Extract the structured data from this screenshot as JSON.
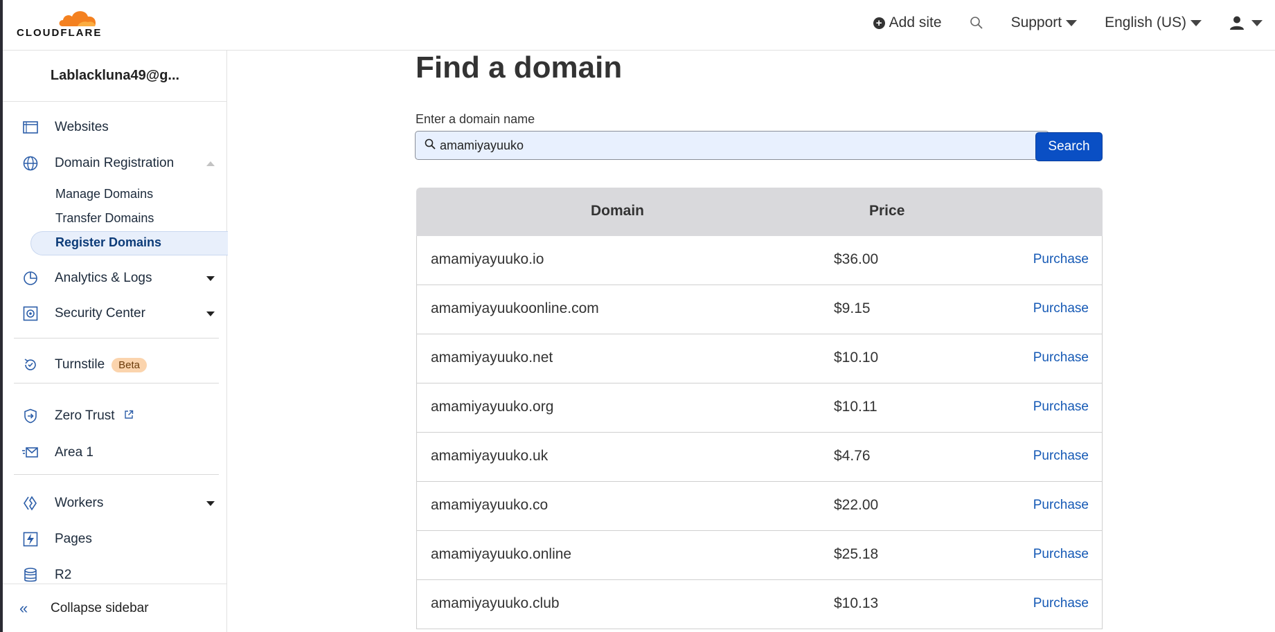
{
  "header": {
    "logo_text": "CLOUDFLARE",
    "add_site": "Add site",
    "support": "Support",
    "language": "English (US)"
  },
  "sidebar": {
    "account": "Lablackluna49@g...",
    "items": {
      "websites": "Websites",
      "domain_registration": "Domain Registration",
      "manage_domains": "Manage Domains",
      "transfer_domains": "Transfer Domains",
      "register_domains": "Register Domains",
      "analytics_logs": "Analytics & Logs",
      "security_center": "Security Center",
      "turnstile": "Turnstile",
      "turnstile_badge": "Beta",
      "zero_trust": "Zero Trust",
      "area1": "Area 1",
      "workers": "Workers",
      "pages": "Pages",
      "r2": "R2"
    },
    "collapse": "Collapse sidebar"
  },
  "main": {
    "title": "Find a domain",
    "search_label": "Enter a domain name",
    "search_value": "amamiyayuuko",
    "search_button": "Search",
    "table": {
      "headers": {
        "domain": "Domain",
        "price": "Price"
      },
      "action_label": "Purchase",
      "rows": [
        {
          "domain": "amamiyayuuko.io",
          "price": "$36.00"
        },
        {
          "domain": "amamiyayuukoonline.com",
          "price": "$9.15"
        },
        {
          "domain": "amamiyayuuko.net",
          "price": "$10.10"
        },
        {
          "domain": "amamiyayuuko.org",
          "price": "$10.11"
        },
        {
          "domain": "amamiyayuuko.uk",
          "price": "$4.76"
        },
        {
          "domain": "amamiyayuuko.co",
          "price": "$22.00"
        },
        {
          "domain": "amamiyayuuko.online",
          "price": "$25.18"
        },
        {
          "domain": "amamiyayuuko.club",
          "price": "$10.13"
        }
      ]
    }
  },
  "colors": {
    "brand_orange": "#f48120",
    "primary_blue": "#0a4fc4",
    "link_blue": "#1559b5",
    "active_nav_bg": "#e8effb",
    "beta_badge_bg": "#fbd4ad"
  }
}
